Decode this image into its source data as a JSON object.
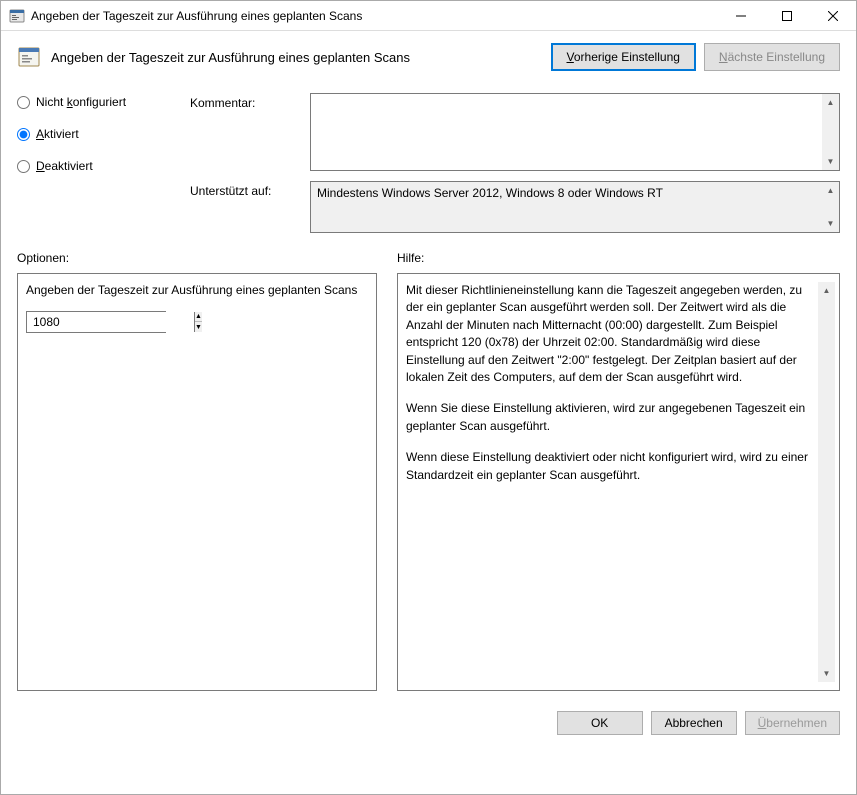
{
  "window": {
    "title": "Angeben der Tageszeit zur Ausführung eines geplanten Scans"
  },
  "header": {
    "title": "Angeben der Tageszeit zur Ausführung eines geplanten Scans",
    "prev_button": "Vorherige Einstellung",
    "next_button": "Nächste Einstellung"
  },
  "radios": {
    "not_configured": "Nicht konfiguriert",
    "activated": "Aktiviert",
    "deactivated": "Deaktiviert",
    "selected": "activated"
  },
  "fields": {
    "comment_label": "Kommentar:",
    "comment_value": "",
    "supported_label": "Unterstützt auf:",
    "supported_value": "Mindestens Windows Server 2012, Windows 8 oder Windows RT"
  },
  "panels": {
    "options_label": "Optionen:",
    "help_label": "Hilfe:"
  },
  "options": {
    "description": "Angeben der Tageszeit zur Ausführung eines geplanten Scans",
    "value": "1080"
  },
  "help": {
    "p1": "Mit dieser Richtlinieneinstellung kann die Tageszeit angegeben werden, zu der ein geplanter Scan ausgeführt werden soll. Der Zeitwert wird als die Anzahl der Minuten nach Mitternacht (00:00) dargestellt.  Zum Beispiel entspricht 120 (0x78) der Uhrzeit 02:00. Standardmäßig wird diese Einstellung auf den Zeitwert \"2:00\" festgelegt. Der Zeitplan basiert auf der lokalen Zeit des Computers, auf dem der Scan ausgeführt wird.",
    "p2": "Wenn Sie diese Einstellung aktivieren, wird zur angegebenen Tageszeit ein geplanter Scan ausgeführt.",
    "p3": "Wenn diese Einstellung deaktiviert oder nicht konfiguriert wird, wird zu einer Standardzeit ein geplanter Scan ausgeführt."
  },
  "footer": {
    "ok": "OK",
    "cancel": "Abbrechen",
    "apply": "Übernehmen"
  }
}
